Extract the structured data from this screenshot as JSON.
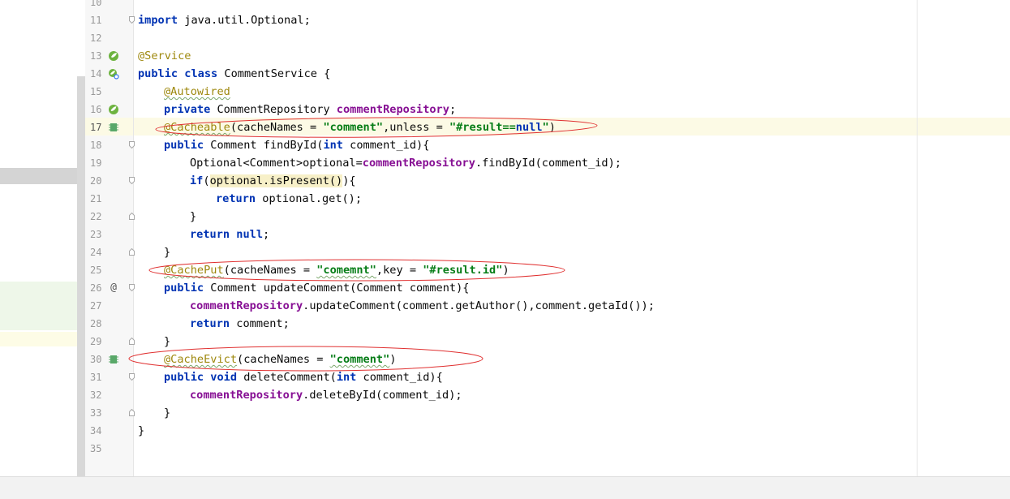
{
  "editor": {
    "line_numbers": [
      "10",
      "11",
      "12",
      "13",
      "14",
      "15",
      "16",
      "17",
      "18",
      "19",
      "20",
      "21",
      "22",
      "23",
      "24",
      "25",
      "26",
      "27",
      "28",
      "29",
      "30",
      "31",
      "32",
      "33",
      "34",
      "35"
    ],
    "code": {
      "l11": {
        "kw": "import",
        "rest": " java.util.Optional;"
      },
      "l13": {
        "ann": "@Service"
      },
      "l14": {
        "kw1": "public",
        "kw2": "class",
        "rest": " CommentService {"
      },
      "l15": {
        "ann": "@Autowired"
      },
      "l16": {
        "kw": "private",
        "type": " CommentRepository ",
        "field": "commentRepository",
        "end": ";"
      },
      "l17": {
        "ann": "@Cacheable",
        "p1": "(cacheNames = ",
        "s1": "\"comment\"",
        "p2": ",unless = ",
        "s2": "\"#result==",
        "s2kw": "null",
        "s2end": "\"",
        "end": ")"
      },
      "l18": {
        "kw": "public",
        "mid": " Comment findById(",
        "kw2": "int",
        "end": " comment_id){"
      },
      "l19": {
        "p1": "Optional<Comment>optional=",
        "field": "commentRepository",
        "end": ".findById(comment_id);"
      },
      "l20": {
        "kw": "if",
        "p1": "(",
        "hl": "optional.isPresent()",
        "end": "){"
      },
      "l21": {
        "kw": "return",
        "end": " optional.get();"
      },
      "l22": {
        "end": "}"
      },
      "l23": {
        "kw": "return",
        "kw2": "null",
        "end": ";"
      },
      "l24": {
        "end": "}"
      },
      "l25": {
        "ann": "@CachePut",
        "p1": "(cacheNames = ",
        "s1": "\"comemnt\"",
        "p2": ",key = ",
        "s2": "\"#result.id\"",
        "end": ")"
      },
      "l26": {
        "kw": "public",
        "end": " Comment updateComment(Comment comment){"
      },
      "l27": {
        "field": "commentRepository",
        "end": ".updateComment(comment.getAuthor(),comment.getaId());"
      },
      "l28": {
        "kw": "return",
        "end": " comment;"
      },
      "l29": {
        "end": "}"
      },
      "l30": {
        "ann": "@CacheEvict",
        "p1": "(cacheNames = ",
        "s1": "\"comment\"",
        "end": ")"
      },
      "l31": {
        "kw": "public",
        "kw2": "void",
        "mid": " deleteComment(",
        "kw3": "int",
        "end": " comment_id){"
      },
      "l32": {
        "field": "commentRepository",
        "end": ".deleteById(comment_id);"
      },
      "l33": {
        "end": "}"
      },
      "l34": {
        "end": "}"
      }
    },
    "gutter_icons": {
      "l13": "spring-bean-icon",
      "l14": "spring-bean-search-icon",
      "l16": "spring-bean-navigate-icon",
      "l17": "cache-icon",
      "l26": "override-at-icon",
      "l26_glyph": "@",
      "l30": "cache-icon"
    },
    "colors": {
      "keyword": "#0033b3",
      "annotation": "#9e880d",
      "string": "#067d17",
      "field": "#871094",
      "oval": "#e03030",
      "current_line": "#fcfae5"
    }
  }
}
